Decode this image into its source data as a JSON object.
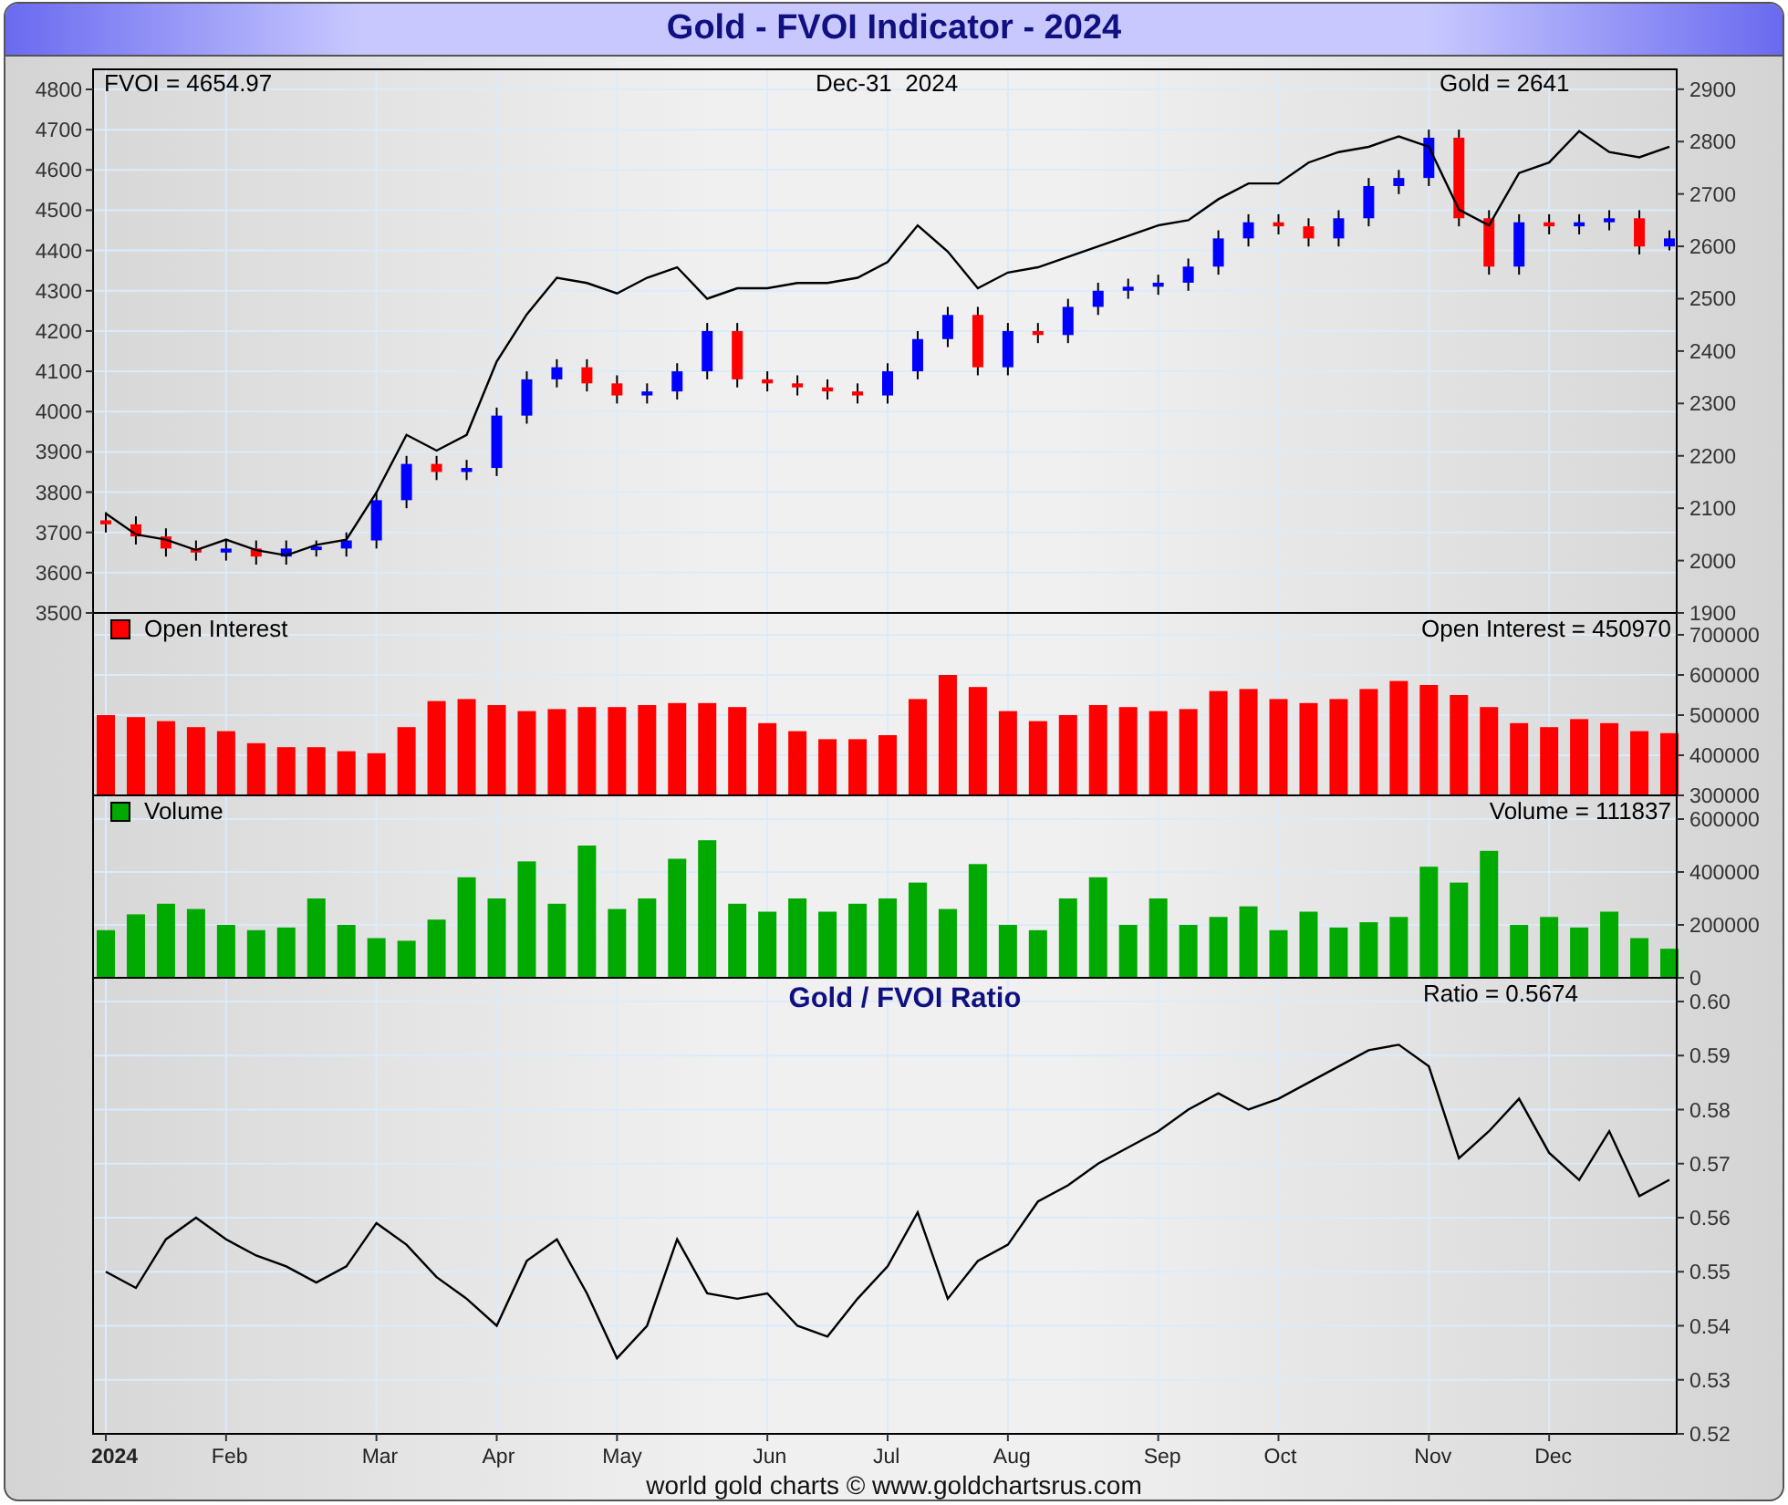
{
  "title": "Gold - FVOI Indicator - 2024",
  "price_panel": {
    "fvoi_reading": "FVOI = 4654.97",
    "date": "Dec-31  2024",
    "candles": {
      "chart_data": {
        "type": "candlestick",
        "grid": true,
        "ylim": [
          3500,
          4800
        ],
        "yticks": [
          3500,
          3600,
          3700,
          3800,
          3900,
          4000,
          4100,
          4200,
          4300,
          4400,
          4500,
          4600,
          4700,
          4800
        ],
        "ohlc": [
          [
            3730,
            3750,
            3700,
            3720
          ],
          [
            3720,
            3740,
            3670,
            3690
          ],
          [
            3690,
            3710,
            3640,
            3660
          ],
          [
            3660,
            3680,
            3630,
            3650
          ],
          [
            3650,
            3680,
            3630,
            3660
          ],
          [
            3660,
            3680,
            3620,
            3640
          ],
          [
            3640,
            3680,
            3620,
            3660
          ],
          [
            3660,
            3680,
            3640,
            3665
          ],
          [
            3660,
            3700,
            3640,
            3680
          ],
          [
            3680,
            3800,
            3660,
            3780
          ],
          [
            3780,
            3890,
            3760,
            3870
          ],
          [
            3870,
            3890,
            3830,
            3850
          ],
          [
            3850,
            3880,
            3830,
            3860
          ],
          [
            3860,
            4010,
            3840,
            3990
          ],
          [
            3990,
            4100,
            3970,
            4080
          ],
          [
            4080,
            4130,
            4060,
            4110
          ],
          [
            4110,
            4130,
            4050,
            4070
          ],
          [
            4070,
            4090,
            4020,
            4040
          ],
          [
            4040,
            4070,
            4020,
            4050
          ],
          [
            4050,
            4120,
            4030,
            4100
          ],
          [
            4100,
            4220,
            4080,
            4200
          ],
          [
            4200,
            4220,
            4060,
            4080
          ],
          [
            4080,
            4100,
            4050,
            4070
          ],
          [
            4070,
            4090,
            4040,
            4060
          ],
          [
            4060,
            4080,
            4030,
            4050
          ],
          [
            4050,
            4070,
            4020,
            4040
          ],
          [
            4040,
            4120,
            4020,
            4100
          ],
          [
            4100,
            4200,
            4080,
            4180
          ],
          [
            4180,
            4260,
            4160,
            4240
          ],
          [
            4240,
            4260,
            4090,
            4110
          ],
          [
            4110,
            4220,
            4090,
            4200
          ],
          [
            4200,
            4220,
            4170,
            4190
          ],
          [
            4190,
            4280,
            4170,
            4260
          ],
          [
            4260,
            4320,
            4240,
            4300
          ],
          [
            4300,
            4330,
            4280,
            4310
          ],
          [
            4310,
            4340,
            4290,
            4320
          ],
          [
            4320,
            4380,
            4300,
            4360
          ],
          [
            4360,
            4450,
            4340,
            4430
          ],
          [
            4430,
            4490,
            4410,
            4470
          ],
          [
            4470,
            4490,
            4440,
            4460
          ],
          [
            4460,
            4480,
            4410,
            4430
          ],
          [
            4430,
            4500,
            4410,
            4480
          ],
          [
            4480,
            4580,
            4460,
            4560
          ],
          [
            4560,
            4600,
            4540,
            4580
          ],
          [
            4580,
            4700,
            4560,
            4680
          ],
          [
            4680,
            4700,
            4460,
            4480
          ],
          [
            4480,
            4500,
            4340,
            4360
          ],
          [
            4360,
            4490,
            4340,
            4470
          ],
          [
            4470,
            4490,
            4440,
            4460
          ],
          [
            4460,
            4490,
            4440,
            4470
          ],
          [
            4470,
            4500,
            4450,
            4480
          ],
          [
            4480,
            4500,
            4390,
            4410
          ],
          [
            4410,
            4450,
            4400,
            4430
          ]
        ]
      }
    },
    "gold_line": {
      "reading": "Gold = 2641",
      "chart_data": {
        "type": "line",
        "ylim": [
          1900,
          2938
        ],
        "yticks": [
          1900,
          2000,
          2100,
          2200,
          2300,
          2400,
          2500,
          2600,
          2700,
          2800,
          2900
        ],
        "series": [
          {
            "color": "#000000",
            "values": [
              2090,
              2050,
              2040,
              2020,
              2040,
              2020,
              2010,
              2030,
              2040,
              2130,
              2240,
              2210,
              2240,
              2380,
              2470,
              2540,
              2530,
              2510,
              2540,
              2560,
              2500,
              2520,
              2520,
              2530,
              2530,
              2540,
              2570,
              2640,
              2590,
              2520,
              2550,
              2560,
              2580,
              2600,
              2620,
              2640,
              2650,
              2690,
              2720,
              2720,
              2760,
              2780,
              2790,
              2810,
              2790,
              2670,
              2640,
              2740,
              2760,
              2820,
              2780,
              2770,
              2790
            ]
          }
        ]
      }
    }
  },
  "open_interest_panel": {
    "reading": "Open Interest = 450970",
    "chart_data": {
      "type": "bar",
      "grid": true,
      "ylim": [
        300000,
        700000
      ],
      "yticks": [
        300000,
        400000,
        500000,
        600000,
        700000
      ],
      "series": [
        {
          "name": "Open Interest",
          "color": "#ff0000",
          "values": [
            500000,
            495000,
            485000,
            470000,
            460000,
            430000,
            420000,
            420000,
            410000,
            405000,
            470000,
            535000,
            540000,
            525000,
            510000,
            515000,
            520000,
            520000,
            525000,
            530000,
            530000,
            520000,
            480000,
            460000,
            440000,
            440000,
            450000,
            540000,
            600000,
            570000,
            510000,
            485000,
            500000,
            525000,
            520000,
            510000,
            515000,
            560000,
            565000,
            540000,
            530000,
            540000,
            565000,
            585000,
            575000,
            550000,
            520000,
            480000,
            470000,
            490000,
            480000,
            460000,
            455000
          ]
        }
      ]
    }
  },
  "volume_panel": {
    "reading": "Volume = 111837",
    "chart_data": {
      "type": "bar",
      "grid": true,
      "ylim": [
        0,
        600000
      ],
      "yticks": [
        0,
        200000,
        400000,
        600000
      ],
      "series": [
        {
          "name": "Volume",
          "color": "#00aa00",
          "values": [
            180000,
            240000,
            280000,
            260000,
            200000,
            180000,
            190000,
            300000,
            200000,
            150000,
            140000,
            220000,
            380000,
            300000,
            440000,
            280000,
            500000,
            260000,
            300000,
            450000,
            520000,
            280000,
            250000,
            300000,
            250000,
            280000,
            300000,
            360000,
            260000,
            430000,
            200000,
            180000,
            300000,
            380000,
            200000,
            300000,
            200000,
            230000,
            270000,
            180000,
            250000,
            190000,
            210000,
            230000,
            420000,
            360000,
            480000,
            200000,
            230000,
            190000,
            250000,
            150000,
            110000
          ]
        }
      ]
    }
  },
  "ratio_panel": {
    "reading": "Ratio = 0.5674",
    "chart_data": {
      "type": "line",
      "title": "Gold / FVOI Ratio",
      "grid": true,
      "ylim": [
        0.52,
        0.6
      ],
      "yticks": [
        0.52,
        0.53,
        0.54,
        0.55,
        0.56,
        0.57,
        0.58,
        0.59,
        {
          "value": 0.6,
          "label": "0.60"
        }
      ],
      "categories": [
        "2024",
        null,
        null,
        null,
        "Feb",
        null,
        null,
        null,
        null,
        "Mar",
        null,
        null,
        null,
        "Apr",
        null,
        null,
        null,
        "May",
        null,
        null,
        null,
        null,
        "Jun",
        null,
        null,
        null,
        "Jul",
        null,
        null,
        null,
        "Aug",
        null,
        null,
        null,
        null,
        "Sep",
        null,
        null,
        null,
        "Oct",
        null,
        null,
        null,
        null,
        "Nov",
        null,
        null,
        null,
        "Dec",
        null,
        null,
        null,
        null
      ],
      "series": [
        {
          "color": "#000000",
          "values": [
            0.55,
            0.547,
            0.556,
            0.56,
            0.556,
            0.553,
            0.551,
            0.548,
            0.551,
            0.559,
            0.555,
            0.549,
            0.545,
            0.54,
            0.552,
            0.556,
            0.546,
            0.534,
            0.54,
            0.556,
            0.546,
            0.545,
            0.546,
            0.54,
            0.538,
            0.545,
            0.551,
            0.561,
            0.545,
            0.552,
            0.555,
            0.563,
            0.566,
            0.57,
            0.573,
            0.576,
            0.58,
            0.583,
            0.58,
            0.582,
            0.585,
            0.588,
            0.591,
            0.592,
            0.588,
            0.571,
            0.576,
            0.582,
            0.572,
            0.567,
            0.576,
            0.564,
            0.567
          ]
        }
      ]
    }
  },
  "footer": "world gold charts © www.goldchartsrus.com"
}
